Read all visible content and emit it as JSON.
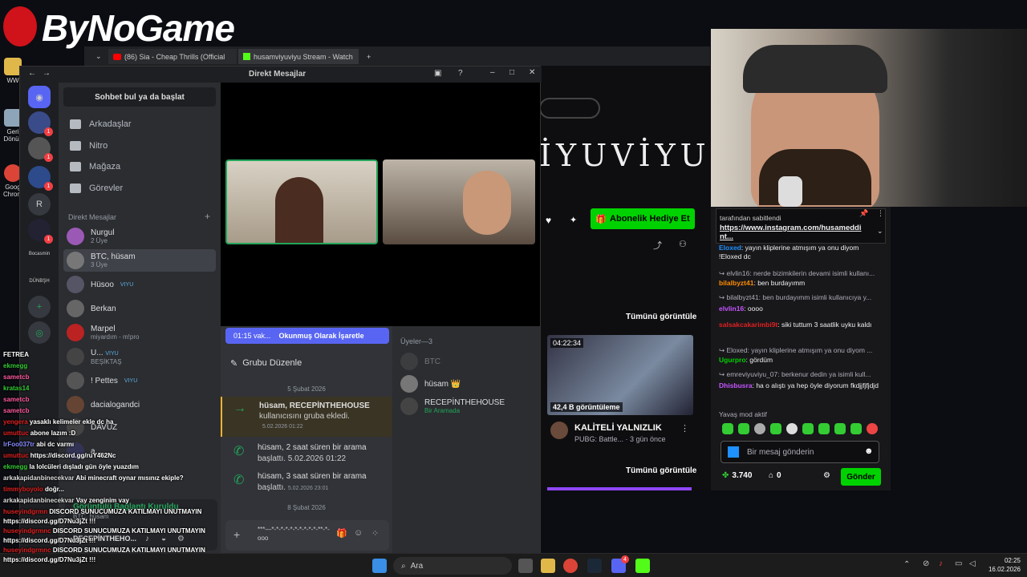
{
  "logo": {
    "text": "ByNoGame"
  },
  "browser": {
    "tabs": [
      {
        "label": "(86) Sia - Cheap Thrills (Official"
      },
      {
        "label": "husamviyuviyu Stream - Watch"
      }
    ]
  },
  "desktop": {
    "icons": [
      {
        "label": "WW"
      },
      {
        "label": "Geri Dönüş"
      },
      {
        "label": "Goog Chrom"
      }
    ]
  },
  "discord": {
    "window_title": "Direkt Mesajlar",
    "search_label": "Sohbet bul ya da başlat",
    "nav": [
      {
        "label": "Arkadaşlar"
      },
      {
        "label": "Nitro"
      },
      {
        "label": "Mağaza"
      },
      {
        "label": "Görevler"
      }
    ],
    "dm_header": "Direkt Mesajlar",
    "servers": [
      {
        "label": "R"
      },
      {
        "label": "Bocasmin"
      },
      {
        "label": "DÜNBŞH"
      }
    ],
    "dms": [
      {
        "name": "Nurgul",
        "sub": "2 Üye"
      },
      {
        "name": "BTC, hüsam",
        "sub": "3 Üye"
      },
      {
        "name": "Hüsoo",
        "sub": "",
        "badge": "VIYU"
      },
      {
        "name": "Berkan",
        "sub": ""
      },
      {
        "name": "Marpel",
        "sub": "miyardım - m!pro"
      },
      {
        "name": "U...",
        "sub": "BEŞİKTAŞ",
        "badge": "VIYU"
      },
      {
        "name": "! Pettes",
        "sub": "",
        "badge": "VIYU"
      },
      {
        "name": "dacialogandci",
        "sub": ""
      },
      {
        "name": "DAVUZ",
        "sub": ""
      },
      {
        "name": "a...",
        "sub": ""
      }
    ],
    "call_status": "Görüntülü Bağlantı Kuruldu",
    "call_sub": "BTC, hüsam",
    "self_name": "RECEPİNTHEHO...",
    "unread_time": "01:15 vak...",
    "mark_read": "Okunmuş Olarak İşaretle",
    "edit_group": "Grubu Düzenle",
    "date1": "5 Şubat 2026",
    "date2": "8 Şubat 2026",
    "messages": [
      {
        "title": "hüsam, RECEPİNTHEHOUSE",
        "body": "kullanıcısını gruba ekledi.",
        "time": "5.02.2026 01:22"
      },
      {
        "title": "hüsam, 2 saat süren bir arama",
        "body": "başlattı. 5.02.2026 01:22",
        "time": ""
      },
      {
        "title": "hüsam, 3 saat süren bir arama",
        "body": "başlattı.",
        "time": "5.02.2026 23:01"
      }
    ],
    "input_text": "***—*-*-*-*-*-*-*-*-*-*-**-*-ooo",
    "members_header": "Üyeler—3",
    "members": [
      {
        "name": "BTC",
        "sub": ""
      },
      {
        "name": "hüsam",
        "sub": "👑"
      },
      {
        "name": "RECEPİNTHEHOUSE",
        "sub": "Bir Aramada"
      }
    ]
  },
  "stream": {
    "channel_banner": "İYUVİYU",
    "gift_button": "Abonelik Hediye Et",
    "view_all_1": "Tümünü görüntüle",
    "view_all_2": "Tümünü görüntüle",
    "video_duration": "04:22:34",
    "video_views": "42,4 B görüntüleme",
    "video_title": "KALİTELİ YALNIZLIK",
    "video_meta": "PUBG: Battle... · 3 gün önce"
  },
  "twitch_chat": {
    "pinned_prefix": "tarafından sabitlendi",
    "pinned_link": "https://www.instagram.com/husameddi nt...",
    "lines": [
      {
        "user": "Eloxed",
        "text": "yayın kliplerine atmışım ya onu diyom !Eloxed dc"
      },
      {
        "user": "elvlin16",
        "text": "nerde bizimkilerin devami isimli kullanı..."
      },
      {
        "user": "bilalbyzt41",
        "text": "ben burdayımm"
      },
      {
        "user": "bilalbyzt41",
        "text": "ben burdayımm isimli kullanıcıya y..."
      },
      {
        "user": "elvlin16",
        "text": "oooo"
      },
      {
        "user": "salsakcakarimbi9t",
        "text": "siki tuttum 3 saatlik uyku kaldı"
      },
      {
        "user": "Eloxed",
        "text": "yayın kliplerine atmışım ya onu diyom ..."
      },
      {
        "user": "Ugurpro",
        "text": "gördüm"
      },
      {
        "user": "emreviyuviyu_07",
        "text": "berkenur dedin ya isimli kull..."
      },
      {
        "user": "Dhisbusra",
        "text": "ha o alıştı ya hep öyle diyorum fkdjjfjfjdjd"
      }
    ],
    "slow_mode": "Yavaş mod aktif",
    "input_placeholder": "Bir mesaj gönderin",
    "points": "3.740",
    "count": "0",
    "send_button": "Gönder"
  },
  "overlay_chat": [
    {
      "user": "FETREA",
      "text": ""
    },
    {
      "user": "ekmegg",
      "text": ""
    },
    {
      "user": "sametcb",
      "text": ""
    },
    {
      "user": "kratas14",
      "text": ""
    },
    {
      "user": "sametcb",
      "text": ""
    },
    {
      "user": "sametcb",
      "text": ""
    },
    {
      "user": "yengera",
      "text": "yasaklı kelimeler ekle dc ha"
    },
    {
      "user": "umuttuc",
      "text": "abone lazım :D"
    },
    {
      "user": "lrFoo037tr",
      "text": "abi dc varmı"
    },
    {
      "user": "umuttuc",
      "text": "https://discord.gg/ruY462Nc"
    },
    {
      "user": "ekmegg",
      "text": "la lolcüleri dışladı gün öyle yuazdım"
    },
    {
      "user": "arkakapidanbinecekvar",
      "text": "Abi minecraft oynar mısınız ekiple?"
    },
    {
      "user": "timmyboyolo",
      "text": "doğr..."
    },
    {
      "user": "arkakapidanbinecekvar",
      "text": "Vay zenginim vay"
    },
    {
      "user": "huseyindgrmn",
      "text": "DISCORD SUNUCUMUZA KATILMAYI UNUTMAYIN"
    },
    {
      "user": "",
      "text": "https://discord.gg/D7Nu3jZt !!!"
    },
    {
      "user": "huseyindgrmnc",
      "text": "DISCORD SUNUCUMUZA KATILMAYI UNUTMAYIN"
    },
    {
      "user": "",
      "text": "https://discord.gg/D7Nu3jZt !!!"
    },
    {
      "user": "huseyindgrmnc",
      "text": "DISCORD SUNUCUMUZA KATILMAYI UNUTMAYIN"
    },
    {
      "user": "",
      "text": "https://discord.gg/D7Nu3jZt !!!"
    }
  ],
  "taskbar": {
    "search_label": "Ara",
    "time": "02:25",
    "date": "16.02.2026",
    "badge": "4"
  },
  "colors": {
    "discord_blurple": "#5865f2",
    "twitch_purple": "#9147ff",
    "green": "#00d200"
  }
}
